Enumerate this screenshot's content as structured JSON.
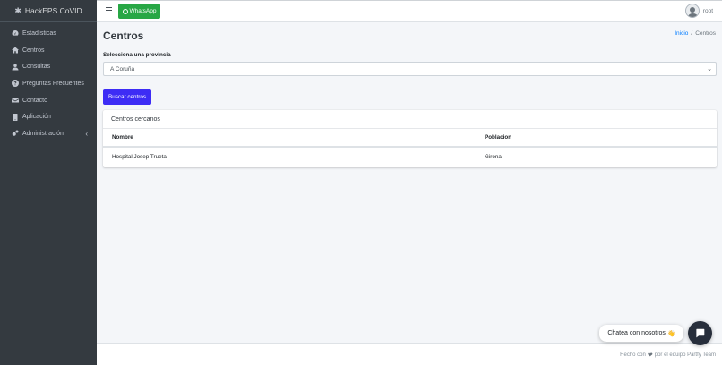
{
  "brand": {
    "name": "HackEPS CoVID",
    "icon": "virus-icon"
  },
  "sidebar": {
    "items": [
      {
        "label": "Estadísticas",
        "icon": "tachometer-icon"
      },
      {
        "label": "Centros",
        "icon": "home-icon"
      },
      {
        "label": "Consultas",
        "icon": "user-icon"
      },
      {
        "label": "Preguntas Frecuentes",
        "icon": "question-circle-icon"
      },
      {
        "label": "Contacto",
        "icon": "envelope-icon"
      },
      {
        "label": "Aplicación",
        "icon": "mobile-icon"
      },
      {
        "label": "Administración",
        "icon": "cogs-icon",
        "chevron": "‹"
      }
    ]
  },
  "header": {
    "whatsapp_label": "WhatsApp",
    "user_name": "root"
  },
  "page": {
    "title": "Centros",
    "breadcrumb": {
      "home": "Inicio",
      "separator": "/",
      "current": "Centros"
    }
  },
  "form": {
    "province_label": "Selecciona una provincia",
    "province_selected": "A Coruña",
    "search_button": "Buscar centros"
  },
  "results": {
    "title": "Centros cercanos",
    "columns": [
      "Nombre",
      "Poblacion"
    ],
    "rows": [
      {
        "nombre": "Hospital Josep Trueta",
        "poblacion": "Girona"
      }
    ]
  },
  "footer": {
    "prefix": "Hecho con",
    "suffix": "por el equipo Partfy Team"
  },
  "chat": {
    "bubble_text": "Chatea con nosotros",
    "emoji": "👋"
  },
  "colors": {
    "sidebar_bg": "#343a40",
    "whatsapp_green": "#28a745",
    "primary_button": "#3d2cf5",
    "link_blue": "#007bff",
    "chat_button": "#272e3b"
  }
}
